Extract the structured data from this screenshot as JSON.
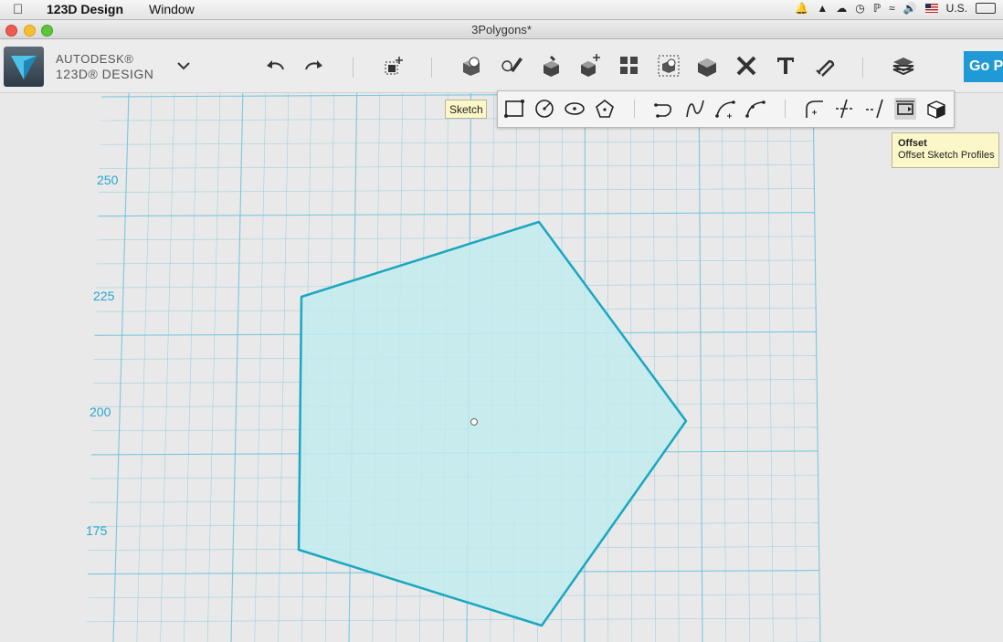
{
  "menubar": {
    "app_name": "123D Design",
    "menus": [
      "Window"
    ],
    "input_source": "U.S."
  },
  "window": {
    "title": "3Polygons*"
  },
  "brand": {
    "line1": "AUTODESK®",
    "line2": "123D® DESIGN"
  },
  "toolbar": {
    "go_pro_label": "Go Pro",
    "accent_color": "#1f9ad6"
  },
  "tooltips": {
    "sketch": "Sketch",
    "offset_title": "Offset",
    "offset_desc": "Offset Sketch Profiles"
  },
  "viewport": {
    "axis_labels": [
      "250",
      "225",
      "200",
      "175"
    ],
    "grid_color": "#6fc3dd",
    "shape_stroke": "#1aa7c0",
    "shape_fill": "#c2ebef"
  }
}
